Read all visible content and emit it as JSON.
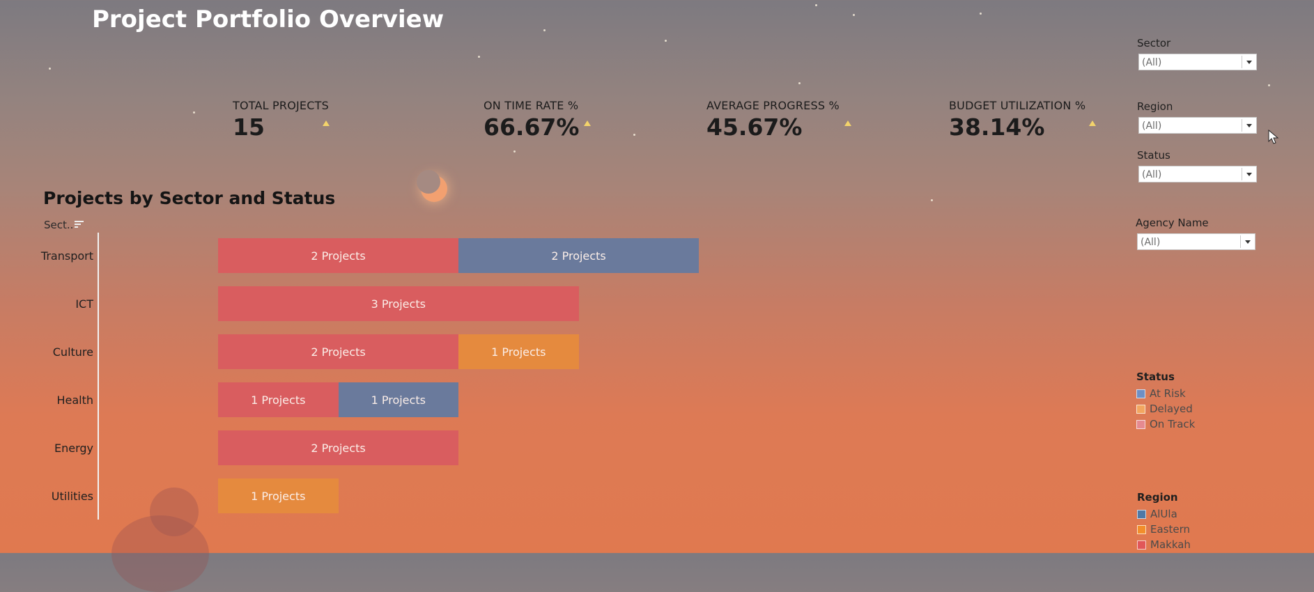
{
  "title": "Project Portfolio Overview",
  "kpis": [
    {
      "label": "TOTAL PROJECTS",
      "value": "15"
    },
    {
      "label": "ON TIME RATE %",
      "value": "66.67%"
    },
    {
      "label": "AVERAGE PROGRESS %",
      "value": "45.67%"
    },
    {
      "label": "BUDGET UTILIZATION %",
      "value": "38.14%"
    }
  ],
  "filters": {
    "sector": {
      "label": "Sector",
      "value": "(All)"
    },
    "region": {
      "label": "Region",
      "value": "(All)"
    },
    "status": {
      "label": "Status",
      "value": "(All)"
    },
    "agency": {
      "label": "Agency Name",
      "value": "(All)"
    }
  },
  "chart": {
    "title": "Projects by Sector and Status",
    "column_header": "Sect..",
    "bar_suffix": " Projects"
  },
  "chart_data": {
    "type": "bar",
    "orientation": "horizontal",
    "stacked": true,
    "title": "Projects by Sector and Status",
    "categories": [
      "Transport",
      "ICT",
      "Culture",
      "Health",
      "Energy",
      "Utilities"
    ],
    "segments": [
      [
        {
          "status": "On Track",
          "value": 2
        },
        {
          "status": "At Risk",
          "value": 2
        }
      ],
      [
        {
          "status": "On Track",
          "value": 3
        }
      ],
      [
        {
          "status": "On Track",
          "value": 2
        },
        {
          "status": "Delayed",
          "value": 1
        }
      ],
      [
        {
          "status": "On Track",
          "value": 1
        },
        {
          "status": "At Risk",
          "value": 1
        }
      ],
      [
        {
          "status": "On Track",
          "value": 2
        }
      ],
      [
        {
          "status": "Delayed",
          "value": 1
        }
      ]
    ]
  },
  "colors": {
    "On Track": "#d95d5f",
    "At Risk": "#6a7a9c",
    "Delayed": "#e58a3e"
  },
  "legends": {
    "status": {
      "title": "Status",
      "items": [
        {
          "label": "At Risk",
          "color": "#6e8fc4"
        },
        {
          "label": "Delayed",
          "color": "#f2a660"
        },
        {
          "label": "On Track",
          "color": "#e58a90"
        }
      ]
    },
    "region": {
      "title": "Region",
      "items": [
        {
          "label": "AlUla",
          "color": "#4e79a7"
        },
        {
          "label": "Eastern",
          "color": "#f28e2b"
        },
        {
          "label": "Makkah",
          "color": "#e15759"
        }
      ]
    }
  }
}
